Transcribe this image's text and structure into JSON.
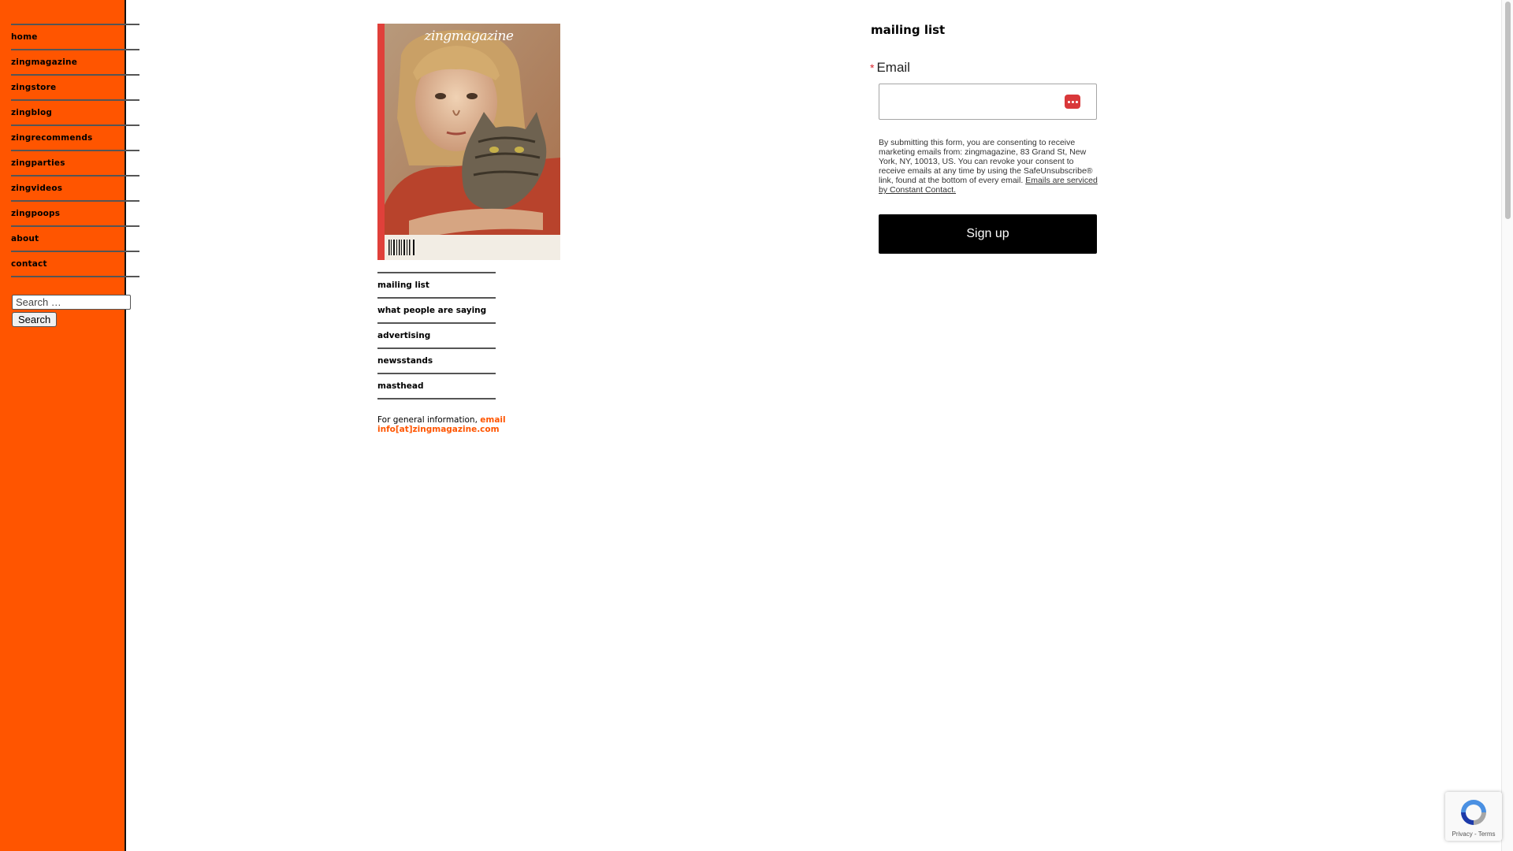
{
  "sidebar": {
    "nav": [
      {
        "label": "home"
      },
      {
        "label": "zingmagazine"
      },
      {
        "label": "zingstore"
      },
      {
        "label": "zingblog"
      },
      {
        "label": "zingrecommends"
      },
      {
        "label": "zingparties"
      },
      {
        "label": "zingvideos"
      },
      {
        "label": "zingpoops"
      },
      {
        "label": "about"
      },
      {
        "label": "contact"
      }
    ],
    "search": {
      "placeholder": "Search …",
      "button_label": "Search"
    },
    "color": "#ff5500"
  },
  "cover": {
    "masthead_text": "zingmagazine",
    "icon": "magazine-cover-image"
  },
  "sub_nav": [
    {
      "label": "mailing list"
    },
    {
      "label": "what people are saying"
    },
    {
      "label": "advertising"
    },
    {
      "label": "newsstands"
    },
    {
      "label": "masthead"
    }
  ],
  "general_info": {
    "prefix": "For general information, ",
    "link_text": "email info[at]zingmagazine.com",
    "link_color": "#ff5500"
  },
  "mailing_list": {
    "title": "mailing list",
    "required_marker": "*",
    "email_label": "Email",
    "email_value": "",
    "autofill_icon": "password-manager-icon",
    "consent_text": "By submitting this form, you are consenting to receive marketing emails from: zingmagazine, 83 Grand St, New York, NY, 10013, US. You can revoke your consent to receive emails at any time by using the SafeUnsubscribe® link, found at the bottom of every email. ",
    "consent_link": "Emails are serviced by Constant Contact.",
    "signup_label": "Sign up"
  },
  "recaptcha": {
    "icon": "recaptcha-logo-icon",
    "links": "Privacy - Terms"
  }
}
